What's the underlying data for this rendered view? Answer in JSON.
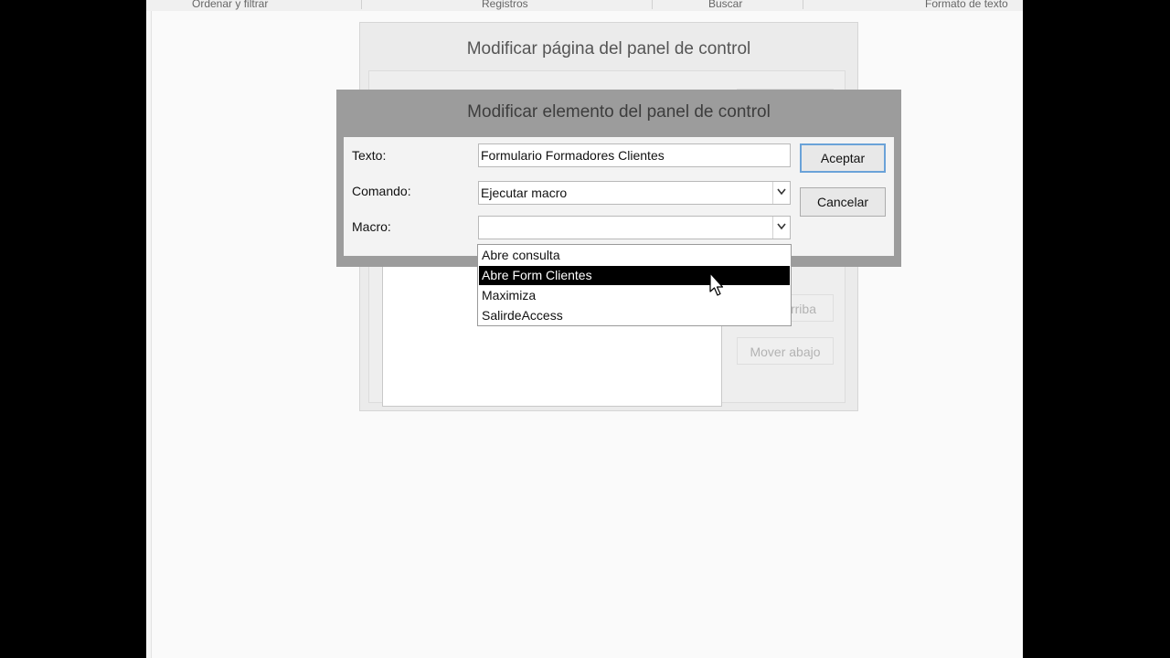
{
  "ribbon": {
    "groups": [
      "Ordenar y filtrar",
      "Registros",
      "Buscar",
      "Formato de texto"
    ]
  },
  "background_dialog": {
    "title": "Modificar página del panel de control",
    "buttons": {
      "up_partial": "rriba",
      "down": "Mover abajo"
    }
  },
  "dialog": {
    "title": "Modificar elemento del panel de control",
    "fields": {
      "texto_label": "Texto:",
      "texto_value": "Formulario Formadores Clientes",
      "comando_label": "Comando:",
      "comando_value": "Ejecutar macro",
      "macro_label": "Macro:",
      "macro_value": ""
    },
    "buttons": {
      "accept": "Aceptar",
      "cancel": "Cancelar"
    }
  },
  "dropdown": {
    "options": [
      "Abre consulta",
      "Abre Form Clientes",
      "Maximiza",
      "SalirdeAccess"
    ],
    "highlighted": "Abre Form Clientes"
  },
  "colors": {
    "dialog_frame": "#9c9c9c",
    "highlight": "#000000",
    "default_button_border": "#6aa2d8"
  }
}
